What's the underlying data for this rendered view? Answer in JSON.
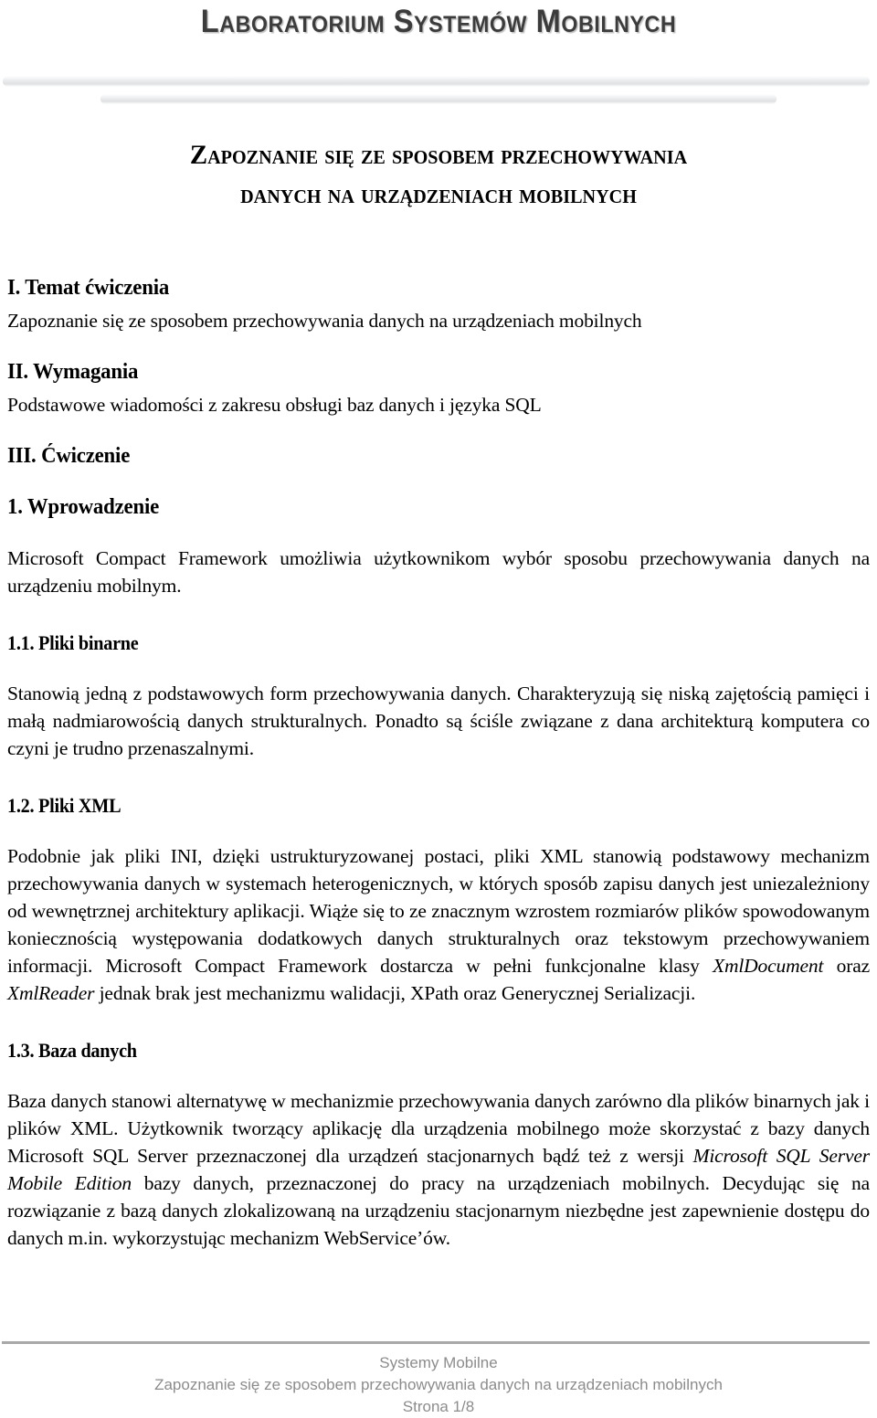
{
  "header": {
    "lab_title": "Laboratorium Systemów Mobilnych"
  },
  "doc_title": {
    "line1": "Zapoznanie się ze sposobem przechowywania",
    "line2": "danych na urządzeniach mobilnych"
  },
  "sections": {
    "s1_heading": "I. Temat ćwiczenia",
    "s1_body": "Zapoznanie się ze sposobem przechowywania danych na urządzeniach mobilnych",
    "s2_heading": "II. Wymagania",
    "s2_body": "Podstawowe wiadomości z zakresu obsługi baz danych i języka SQL",
    "s3_heading": "III. Ćwiczenie",
    "s3_1_heading": "1. Wprowadzenie",
    "s3_1_body": "Microsoft Compact Framework umożliwia użytkownikom wybór sposobu przechowywania danych na urządzeniu mobilnym.",
    "s3_1_1_heading": "1.1. Pliki binarne",
    "s3_1_1_body": "Stanowią jedną z podstawowych form przechowywania danych. Charakteryzują się niską zajętością pamięci i małą nadmiarowością danych strukturalnych. Ponadto są ściśle związane z dana architekturą komputera co czyni je trudno przenaszalnymi.",
    "s3_1_2_heading": "1.2. Pliki XML",
    "s3_1_2_body_a": "Podobnie jak pliki INI, dzięki ustrukturyzowanej postaci, pliki XML stanowią podstawowy mechanizm przechowywania danych w systemach heterogenicznych, w których sposób zapisu danych jest uniezależniony od wewnętrznej architektury aplikacji. Wiąże się to ze znacznym wzrostem rozmiarów plików spowodowanym koniecznością występowania dodatkowych danych strukturalnych oraz tekstowym przechowywaniem informacji. Microsoft Compact Framework dostarcza w pełni funkcjonalne klasy ",
    "s3_1_2_italic_1": "XmlDocument",
    "s3_1_2_body_b": " oraz ",
    "s3_1_2_italic_2": "XmlReader",
    "s3_1_2_body_c": " jednak brak jest mechanizmu walidacji, XPath oraz Generycznej Serializacji.",
    "s3_1_3_heading": "1.3. Baza danych",
    "s3_1_3_body_a": "Baza danych stanowi alternatywę w mechanizmie przechowywania danych zarówno dla plików binarnych jak i plików XML. Użytkownik tworzący aplikację dla urządzenia mobilnego może skorzystać z bazy danych Microsoft SQL Server przeznaczonej dla urządzeń stacjonarnych bądź też z wersji ",
    "s3_1_3_italic_1": "Microsoft SQL Server Mobile Edition",
    "s3_1_3_body_b": " bazy danych, przeznaczonej do pracy na urządzeniach mobilnych. Decydując się na rozwiązanie z bazą danych zlokalizowaną na urządzeniu stacjonarnym niezbędne jest zapewnienie dostępu do danych m.in. wykorzystując mechanizm WebService’ów."
  },
  "footer": {
    "line1": "Systemy Mobilne",
    "line2": "Zapoznanie się ze sposobem przechowywania danych na urządzeniach mobilnych",
    "line3": "Strona 1/8"
  },
  "colors": {
    "header_title": "#3c3c3c",
    "body_text": "#000000",
    "footer_text": "#8c8c8c",
    "footer_rule": "#a8a8a8",
    "bar_light": "#e6e8ea"
  }
}
